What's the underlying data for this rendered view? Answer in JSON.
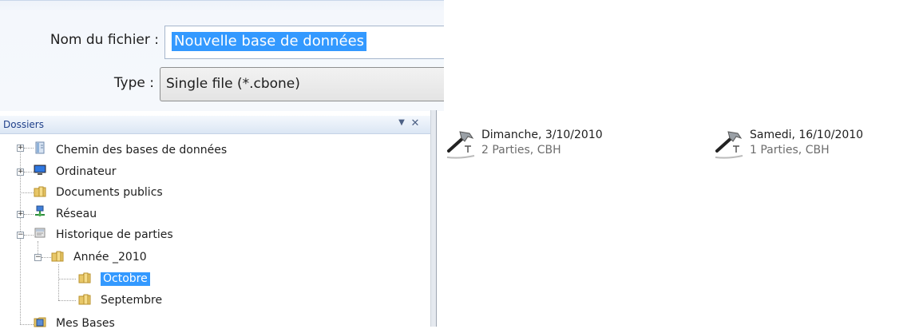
{
  "save_fields": {
    "filename_label": "Nom du fichier :",
    "filename_value": "Nouvelle base de données",
    "type_label": "Type :",
    "type_value": "Single file (*.cbone)"
  },
  "folders_pane": {
    "title": "Dossiers",
    "dropdown_icon": "▼",
    "close_icon": "✕",
    "items": [
      {
        "label": "Chemin des bases de données",
        "expander": "+"
      },
      {
        "label": "Ordinateur",
        "expander": "+"
      },
      {
        "label": "Documents publics"
      },
      {
        "label": "Réseau",
        "expander": "+"
      },
      {
        "label": "Historique de parties",
        "expander": "−"
      },
      {
        "label": "Année _2010",
        "expander": "−"
      },
      {
        "label": "Octobre",
        "selected": true
      },
      {
        "label": "Septembre"
      },
      {
        "label": "Mes Bases"
      }
    ]
  },
  "files": [
    {
      "name": "Dimanche, 3/10/2010",
      "detail": "2 Parties, CBH",
      "icon": "hammer-icon"
    },
    {
      "name": "Samedi, 16/10/2010",
      "detail": "1 Parties, CBH",
      "icon": "hammer-icon"
    }
  ],
  "colors": {
    "selection": "#3399ff",
    "pane_title": "#1e3f8a"
  }
}
